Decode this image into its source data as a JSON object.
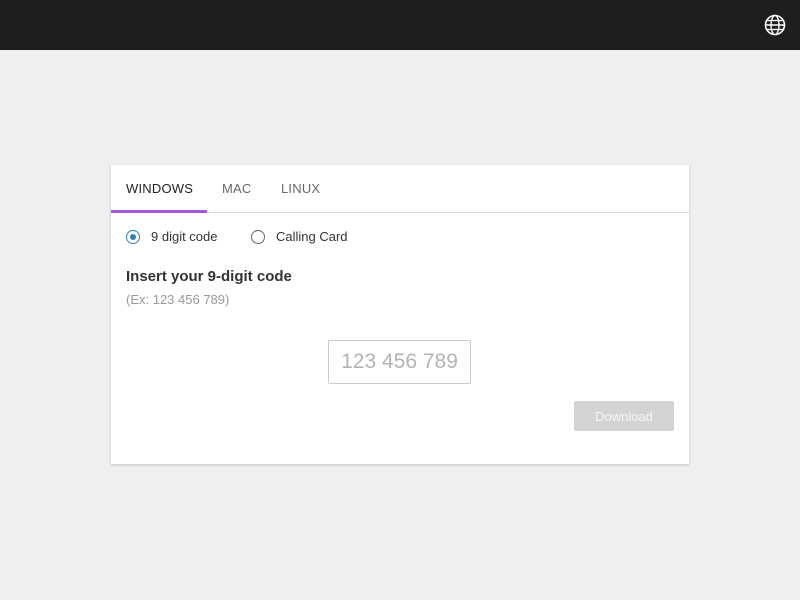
{
  "topbar": {
    "globe_icon": "globe-icon",
    "background": "#1e1e1e"
  },
  "tabs": [
    {
      "label": "WINDOWS",
      "active": true
    },
    {
      "label": "MAC",
      "active": false
    },
    {
      "label": "LINUX",
      "active": false
    }
  ],
  "accent_color": "#a855d6",
  "code_type": {
    "options": [
      {
        "label": "9 digit code",
        "checked": true
      },
      {
        "label": "Calling Card",
        "checked": false
      }
    ],
    "radio_color": "#2f7fc2"
  },
  "form": {
    "heading": "Insert your 9-digit code",
    "hint": "(Ex: 123 456 789)",
    "code_value": "",
    "code_placeholder": "123 456 789"
  },
  "download": {
    "label": "Download",
    "disabled": true
  }
}
